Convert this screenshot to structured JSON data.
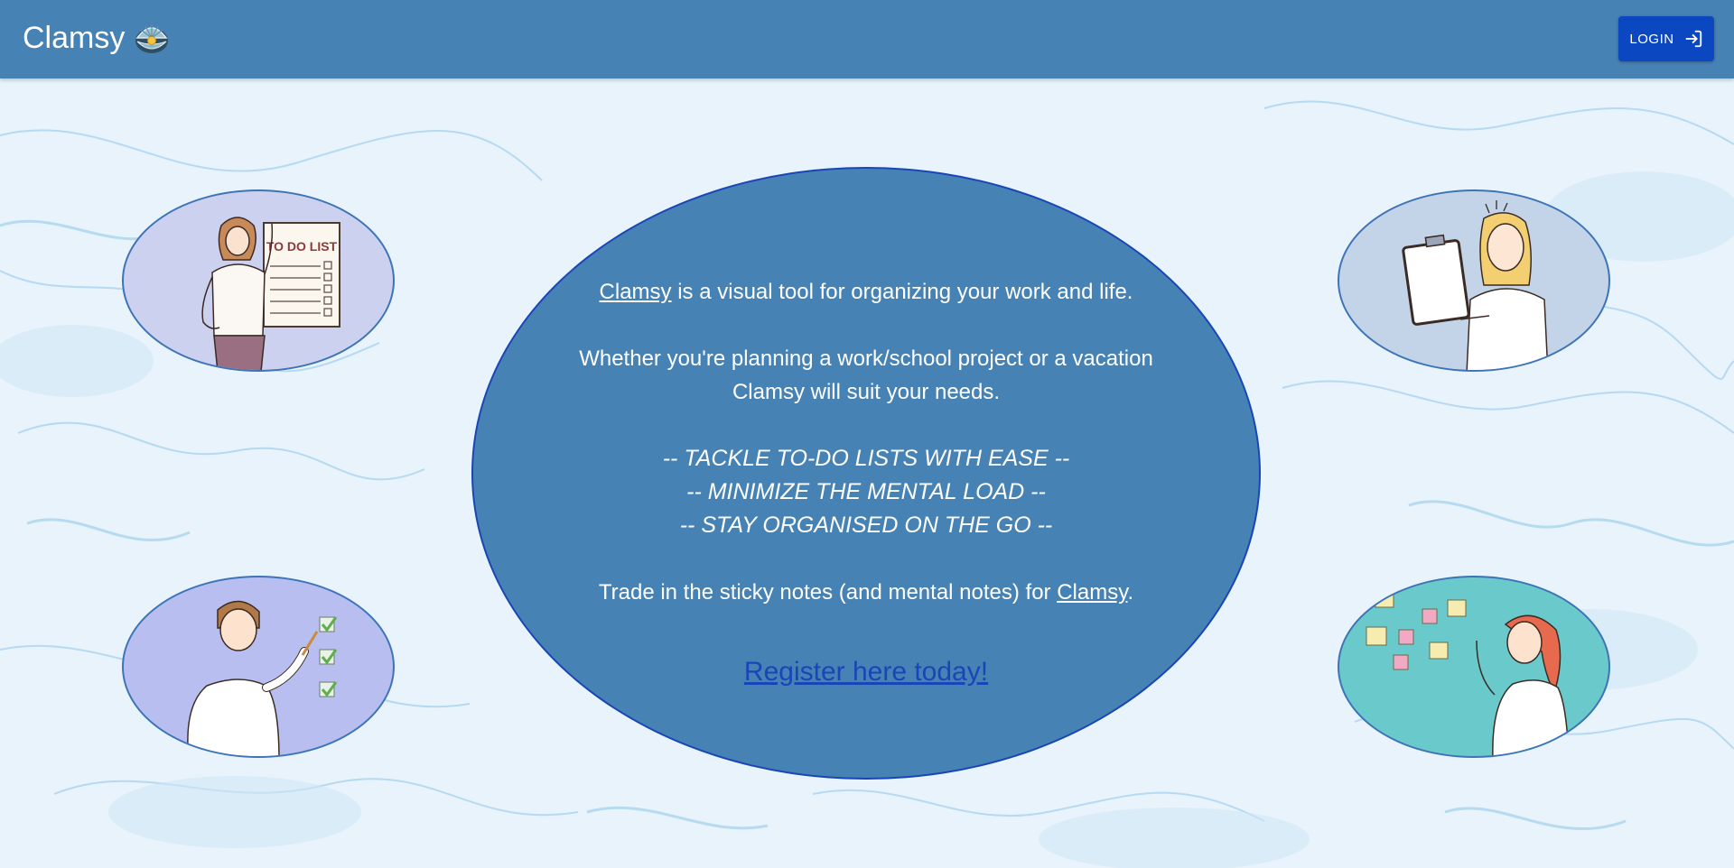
{
  "appbar": {
    "title": "Clamsy",
    "logo_icon": "clam-pearl-icon",
    "login_label": "LOGIN",
    "login_icon": "login-arrow-icon",
    "background_color": "#4682b4",
    "login_color": "#0b47c1"
  },
  "hero": {
    "brand_link_1": "Clamsy",
    "intro_rest": " is a visual tool for organizing your work and life.",
    "para2_line1": "Whether you're planning a work/school project or a vacation",
    "para2_line2": "Clamsy will suit your needs.",
    "tagline_1": "-- TACKLE TO-DO LISTS WITH EASE --",
    "tagline_2": "-- MINIMIZE THE MENTAL LOAD --",
    "tagline_3": "-- STAY ORGANISED ON THE GO --",
    "trade_prefix": "Trade in the sticky notes (and mental notes) for ",
    "brand_link_2": "Clamsy",
    "trade_suffix": ".",
    "register_link": "Register here today!",
    "oval_color": "#4682b4"
  },
  "illustrations": {
    "top_left": {
      "name": "woman-with-todo-list-illustration",
      "sign_text": "TO DO LIST"
    },
    "top_right": {
      "name": "woman-with-clipboard-illustration"
    },
    "bottom_left": {
      "name": "man-checking-list-illustration"
    },
    "bottom_right": {
      "name": "woman-with-sticky-notes-illustration"
    }
  }
}
